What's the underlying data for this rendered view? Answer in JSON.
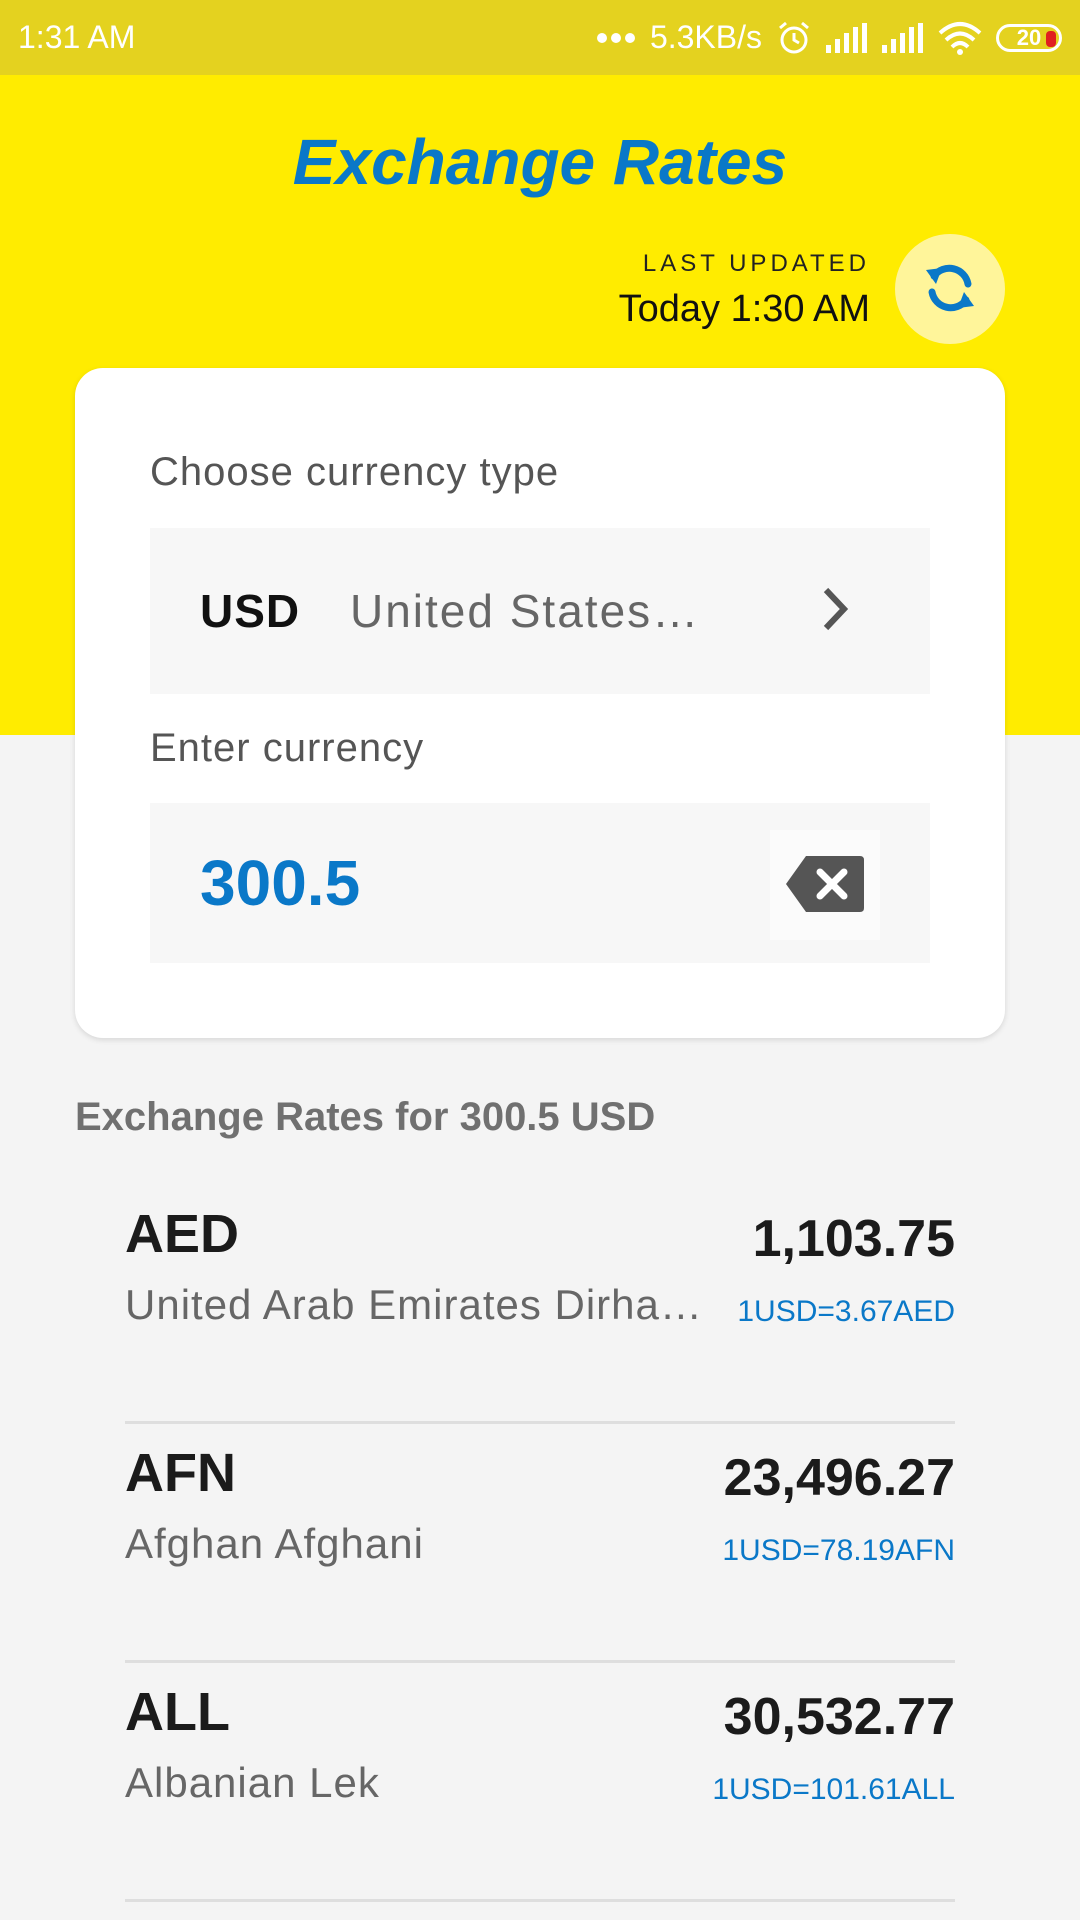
{
  "status_bar": {
    "time": "1:31 AM",
    "network_speed": "5.3KB/s",
    "battery_level": "20",
    "icons": [
      "dots-icon",
      "alarm-icon",
      "signal-icon",
      "signal-icon",
      "wifi-icon",
      "battery-icon"
    ]
  },
  "header": {
    "title": "Exchange Rates",
    "last_updated_label": "LAST UPDATED",
    "last_updated_value": "Today 1:30 AM",
    "refresh_icon": "refresh-icon"
  },
  "card": {
    "currency_label": "Choose currency type",
    "currency_code": "USD",
    "currency_name": "United States…",
    "amount_label": "Enter currency",
    "amount_value": "300.5"
  },
  "section_title": "Exchange Rates for 300.5 USD",
  "rates": [
    {
      "code": "AED",
      "name": "United Arab Emirates Dirha…",
      "value": "1,103.75",
      "rate": "1USD=3.67AED"
    },
    {
      "code": "AFN",
      "name": "Afghan Afghani",
      "value": "23,496.27",
      "rate": "1USD=78.19AFN"
    },
    {
      "code": "ALL",
      "name": "Albanian Lek",
      "value": "30,532.77",
      "rate": "1USD=101.61ALL"
    }
  ],
  "colors": {
    "status_bar": "#e4d21f",
    "header": "#ffec00",
    "accent": "#0a78c8",
    "background": "#f4f4f4"
  }
}
